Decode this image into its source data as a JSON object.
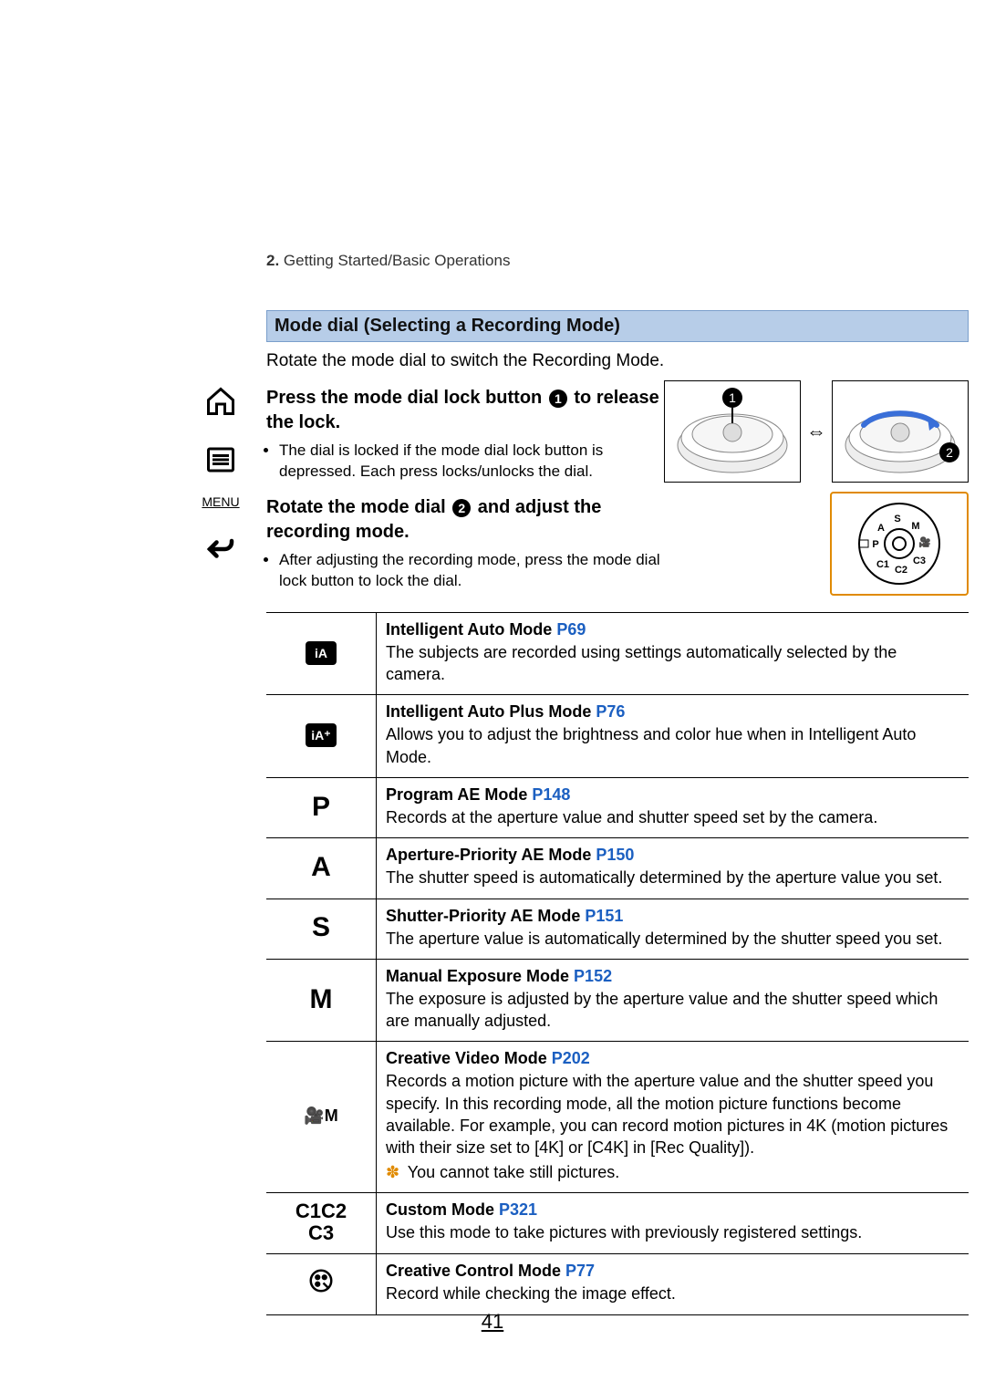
{
  "breadcrumb": {
    "num": "2.",
    "text": "Getting Started/Basic Operations"
  },
  "sidebar": {
    "menu_label": "MENU"
  },
  "section_title": "Mode dial (Selecting a Recording Mode)",
  "intro": "Rotate the mode dial to switch the Recording Mode.",
  "step1": {
    "pre": "Press the mode dial lock button ",
    "badge": "1",
    "post": " to release the lock.",
    "note": "The dial is locked if the mode dial lock button is depressed. Each press locks/unlocks the dial."
  },
  "step2": {
    "pre": "Rotate the mode dial ",
    "badge": "2",
    "post": " and adjust the recording mode.",
    "note": "After adjusting the recording mode, press the mode dial lock button to lock the dial."
  },
  "fig": {
    "badge1": "1",
    "badge2": "2",
    "arrow": "⇔"
  },
  "modes": [
    {
      "icon_text": "iA",
      "icon_kind": "ia",
      "title": "Intelligent Auto Mode ",
      "ref": "P69",
      "desc": "The subjects are recorded using settings automatically selected by the camera."
    },
    {
      "icon_text": "iA⁺",
      "icon_kind": "ia",
      "title": "Intelligent Auto Plus Mode ",
      "ref": "P76",
      "desc": "Allows you to adjust the brightness and color hue when in Intelligent Auto Mode."
    },
    {
      "icon_text": "P",
      "icon_kind": "letter",
      "title": "Program AE Mode ",
      "ref": "P148",
      "desc": "Records at the aperture value and shutter speed set by the camera."
    },
    {
      "icon_text": "A",
      "icon_kind": "letter",
      "title": "Aperture-Priority AE Mode ",
      "ref": "P150",
      "desc": "The shutter speed is automatically determined by the aperture value you set."
    },
    {
      "icon_text": "S",
      "icon_kind": "letter",
      "title": "Shutter-Priority AE Mode ",
      "ref": "P151",
      "desc": "The aperture value is automatically determined by the shutter speed you set."
    },
    {
      "icon_text": "M",
      "icon_kind": "letter",
      "title": "Manual Exposure Mode ",
      "ref": "P152",
      "desc": "The exposure is adjusted by the aperture value and the shutter speed which are manually adjusted."
    },
    {
      "icon_text": "🎥M",
      "icon_kind": "small",
      "title": "Creative Video Mode ",
      "ref": "P202",
      "desc": "Records a motion picture with the aperture value and the shutter speed you specify. In this recording mode, all the motion picture functions become available. For example, you can record motion pictures in 4K (motion pictures with their size set to [4K] or [C4K] in [Rec Quality]).",
      "note_symbol": "✽",
      "note": "You cannot take still pictures."
    },
    {
      "icon_text": "C1C2\nC3",
      "icon_kind": "c123",
      "title": "Custom Mode ",
      "ref": "P321",
      "desc": "Use this mode to take pictures with previously registered settings."
    },
    {
      "icon_text": "🎨",
      "icon_kind": "palette-svg",
      "title": "Creative Control Mode ",
      "ref": "P77",
      "desc": "Record while checking the image effect."
    }
  ],
  "page_number": "41"
}
